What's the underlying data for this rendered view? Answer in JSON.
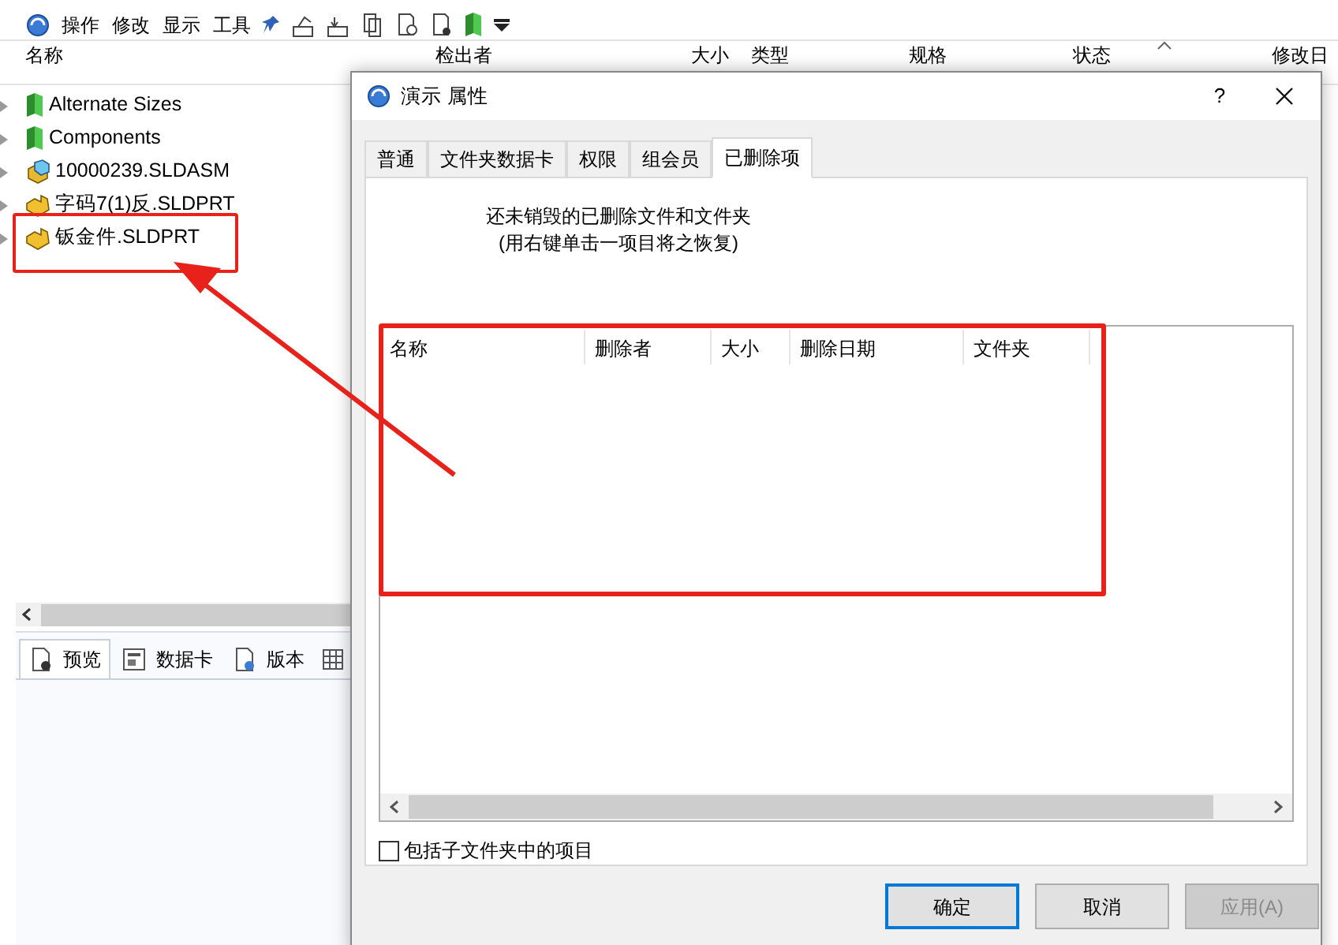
{
  "toolbar": {
    "menus": [
      "操作",
      "修改",
      "显示",
      "工具"
    ]
  },
  "file_list": {
    "columns": [
      "名称",
      "检出者",
      "大小",
      "类型",
      "规格",
      "状态",
      "修改日"
    ],
    "rows": [
      {
        "name": "Alternate Sizes",
        "kind": "folder"
      },
      {
        "name": "Components",
        "kind": "folder"
      },
      {
        "name": "10000239.SLDASM",
        "kind": "assembly"
      },
      {
        "name": "字码7(1)反.SLDPRT",
        "kind": "part"
      },
      {
        "name": "钣金件.SLDPRT",
        "kind": "part"
      }
    ]
  },
  "bottom_tabs": [
    {
      "label": "预览",
      "selected": true,
      "kind": "preview"
    },
    {
      "label": "数据卡",
      "selected": false,
      "kind": "card"
    },
    {
      "label": "版本",
      "selected": false,
      "kind": "version"
    }
  ],
  "dialog": {
    "title": "演示 属性",
    "help": "?",
    "tabs": [
      {
        "label": "普通",
        "selected": false
      },
      {
        "label": "文件夹数据卡",
        "selected": false
      },
      {
        "label": "权限",
        "selected": false
      },
      {
        "label": "组会员",
        "selected": false
      },
      {
        "label": "已删除项",
        "selected": true
      }
    ],
    "message": [
      "还未销毁的已删除文件和文件夹",
      "(用右键单击一项目将之恢复)"
    ],
    "deleted_list": {
      "columns": [
        "名称",
        "删除者",
        "大小",
        "删除日期",
        "文件夹"
      ]
    },
    "include_subfolders": {
      "label": "包括子文件夹中的项目",
      "checked": false
    },
    "buttons": [
      {
        "label": "确定",
        "kind": "default",
        "disabled": false
      },
      {
        "label": "取消",
        "kind": "normal",
        "disabled": false
      },
      {
        "label": "应用(A)",
        "kind": "normal",
        "disabled": true
      }
    ]
  }
}
